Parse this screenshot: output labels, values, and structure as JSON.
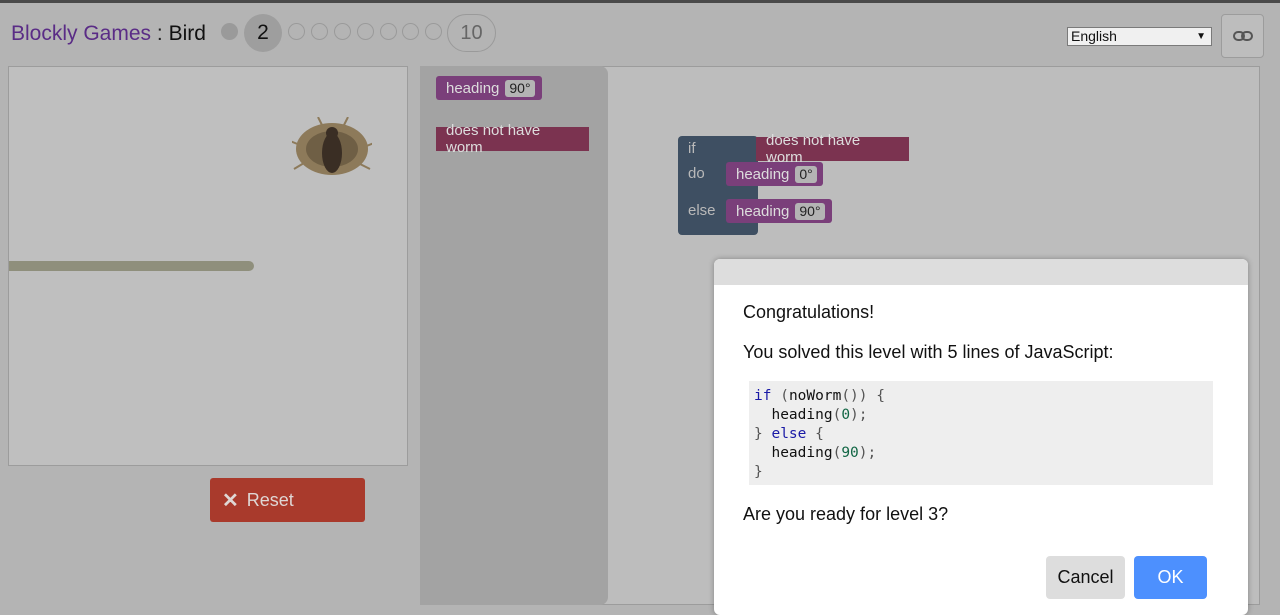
{
  "header": {
    "app_title": "Blockly Games",
    "separator": " : ",
    "game_title": "Bird",
    "current_level": "2",
    "last_level": "10",
    "language": "English"
  },
  "visualization": {
    "reset_label": "Reset"
  },
  "flyout": {
    "heading_label": "heading",
    "heading_value": "90°",
    "condition_label": "does not have worm"
  },
  "workspace": {
    "if_label": "if",
    "do_label": "do",
    "else_label": "else",
    "condition_label": "does not have worm",
    "heading_label_1": "heading",
    "heading_value_1": "0°",
    "heading_label_2": "heading",
    "heading_value_2": "90°"
  },
  "dialog": {
    "congrats": "Congratulations!",
    "summary": "You solved this level with 5 lines of JavaScript:",
    "code_lines": [
      "if (noWorm()) {",
      "  heading(0);",
      "} else {",
      "  heading(90);",
      "}"
    ],
    "question": "Are you ready for level 3?",
    "cancel_label": "Cancel",
    "ok_label": "OK"
  },
  "colors": {
    "accent_blue": "#4d90fe",
    "reset_red": "#a93a2c",
    "title_purple": "#5a2c86"
  }
}
